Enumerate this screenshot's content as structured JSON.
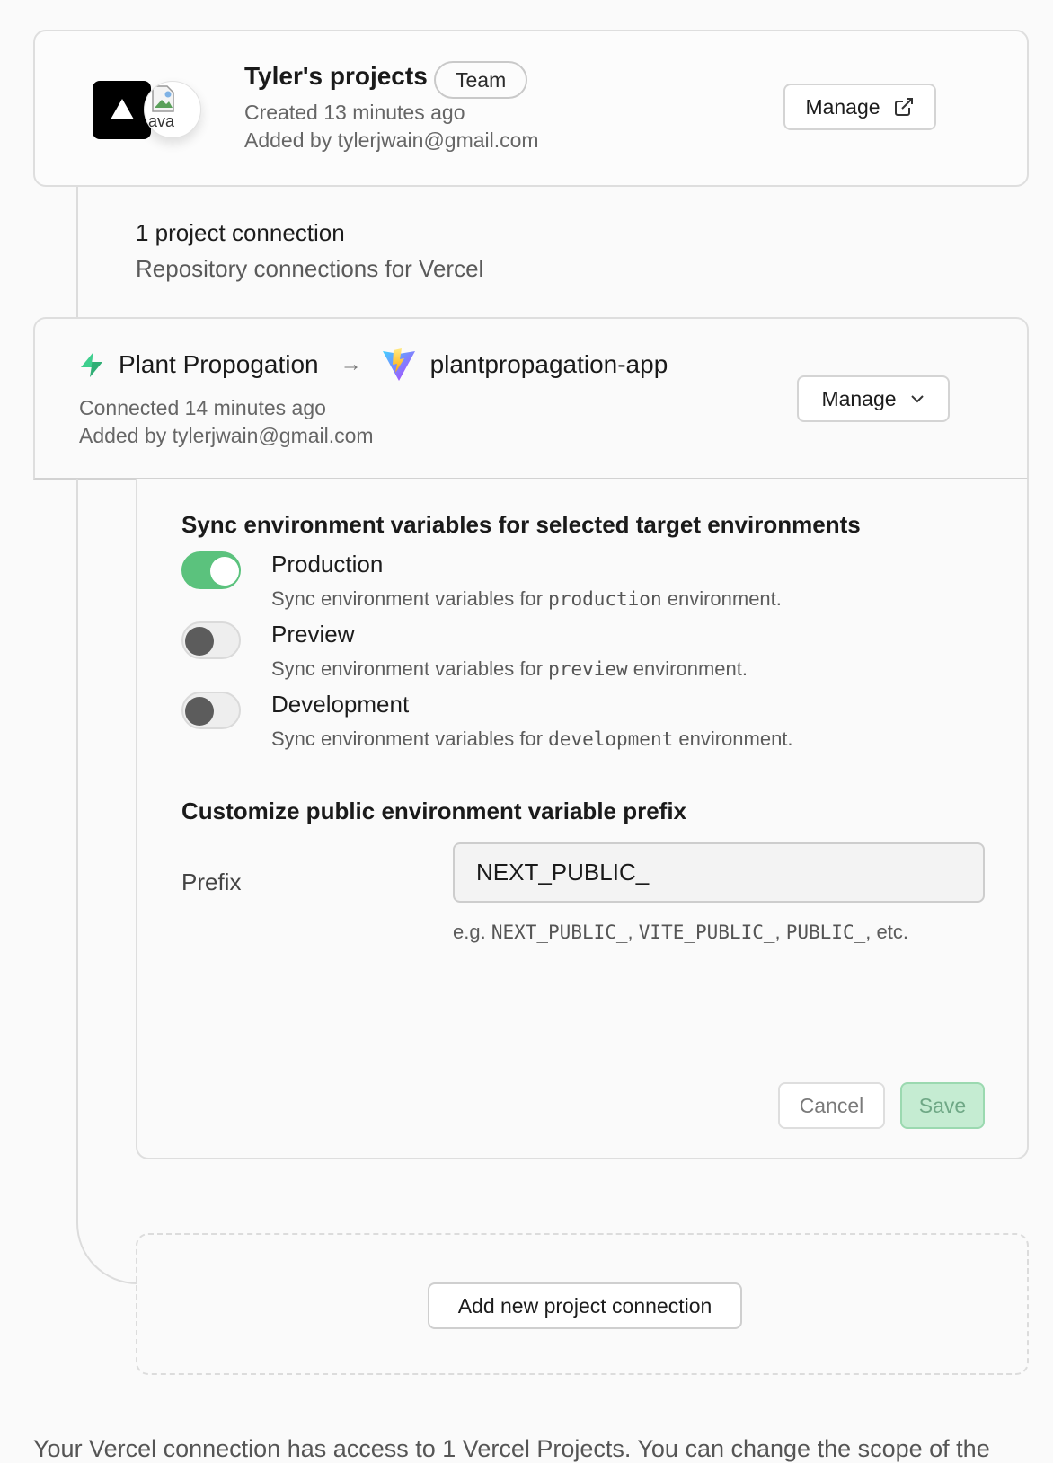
{
  "team": {
    "title": "Tyler's projects",
    "badge": "Team",
    "created": "Created 13 minutes ago",
    "added_by": "Added by tylerjwain@gmail.com",
    "avatar_alt": "ava",
    "manage_label": "Manage"
  },
  "connections": {
    "count_label": "1 project connection",
    "subtitle": "Repository connections for Vercel"
  },
  "project": {
    "source_name": "Plant Propogation",
    "target_name": "plantpropagation-app",
    "connected": "Connected 14 minutes ago",
    "added_by": "Added by tylerjwain@gmail.com",
    "manage_label": "Manage"
  },
  "sync": {
    "title": "Sync environment variables for selected target environments",
    "desc_prefix": "Sync environment variables for",
    "desc_suffix": "environment.",
    "environments": [
      {
        "label": "Production",
        "code": "production",
        "enabled": true
      },
      {
        "label": "Preview",
        "code": "preview",
        "enabled": false
      },
      {
        "label": "Development",
        "code": "development",
        "enabled": false
      }
    ]
  },
  "prefix": {
    "title": "Customize public environment variable prefix",
    "label": "Prefix",
    "value": "NEXT_PUBLIC_",
    "help_prefix": "e.g.",
    "help_codes": [
      "NEXT_PUBLIC_",
      "VITE_PUBLIC_",
      "PUBLIC_"
    ],
    "help_suffix": "etc."
  },
  "actions": {
    "cancel": "Cancel",
    "save": "Save"
  },
  "add_connection_label": "Add new project connection",
  "footer": "Your Vercel connection has access to 1 Vercel Projects. You can change the scope of the",
  "colors": {
    "toggle_on": "#5bc27d",
    "save_bg": "#c5ecd2",
    "supabase_green": "#3ecf8e"
  }
}
